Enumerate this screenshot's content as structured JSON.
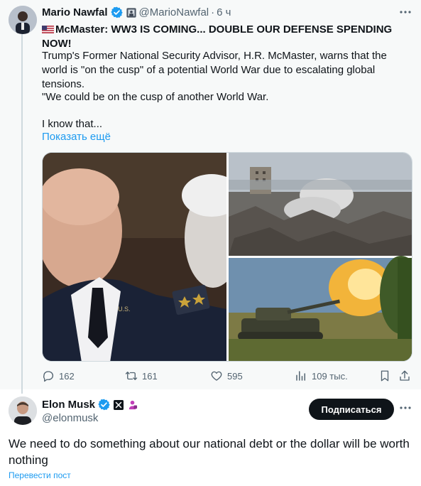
{
  "quoted_post": {
    "author_name": "Mario Nawfal",
    "handle": "@MarioNawfal",
    "separator": "·",
    "time": "6 ч",
    "headline": "McMaster: WW3 IS COMING... DOUBLE OUR DEFENSE SPENDING NOW!",
    "body_paragraph_1": "Trump's Former National Security Advisor, H.R. McMaster, warns that the world is \"on the cusp\" of a potential World War due to escalating global tensions.",
    "body_paragraph_2": "\"We could be on the cusp of another World War.",
    "body_paragraph_3": "I know that...",
    "show_more": "Показать ещё",
    "image_patch_text": "U.S.",
    "stats": {
      "replies": "162",
      "reposts": "161",
      "likes": "595",
      "views": "109 тыс."
    }
  },
  "reply_post": {
    "author_name": "Elon Musk",
    "handle": "@elonmusk",
    "follow_label": "Подписаться",
    "text": "We need to do something about our national debt or the dollar will be worth nothing",
    "translate_label": "Перевести пост"
  },
  "icons": {
    "verified": "verified-badge-icon",
    "affiliate": "affiliate-badge-icon",
    "x_logo": "x-logo-icon",
    "more": "more-horizontal-icon",
    "reply": "reply-icon",
    "repost": "repost-icon",
    "like": "like-icon",
    "views": "views-icon",
    "bookmark": "bookmark-icon",
    "share": "share-icon"
  },
  "colors": {
    "accent_blue": "#1d9bf0",
    "text_primary": "#0f1419",
    "text_secondary": "#536471",
    "quoted_background": "#f7f9f9",
    "follow_button": "#0f1419"
  }
}
